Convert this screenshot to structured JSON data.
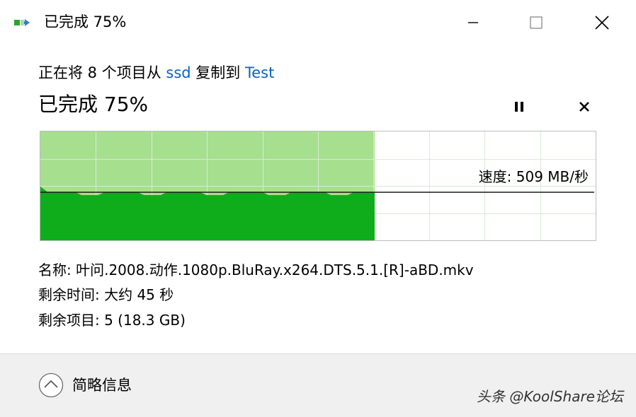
{
  "window": {
    "title": "已完成 75%"
  },
  "dialog": {
    "copy_prefix": "正在将 8 个项目从 ",
    "source": "ssd",
    "copy_middle": " 复制到 ",
    "destination": "Test",
    "status": "已完成 75%",
    "progress_percent": 75
  },
  "speed": {
    "label": "速度: 509 MB/秒"
  },
  "details": {
    "name": "名称: 叶问.2008.动作.1080p.BluRay.x264.DTS.5.1.[R]-aBD.mkv",
    "time_remaining": "剩余时间: 大约 45 秒",
    "items_remaining": "剩余项目: 5 (18.3 GB)"
  },
  "footer": {
    "collapse_label": "简略信息",
    "watermark": "头条 @KoolShare论坛"
  },
  "colors": {
    "progress_light": "#a6df8e",
    "progress_dark": "#0fad1c",
    "link": "#0b62c4"
  }
}
